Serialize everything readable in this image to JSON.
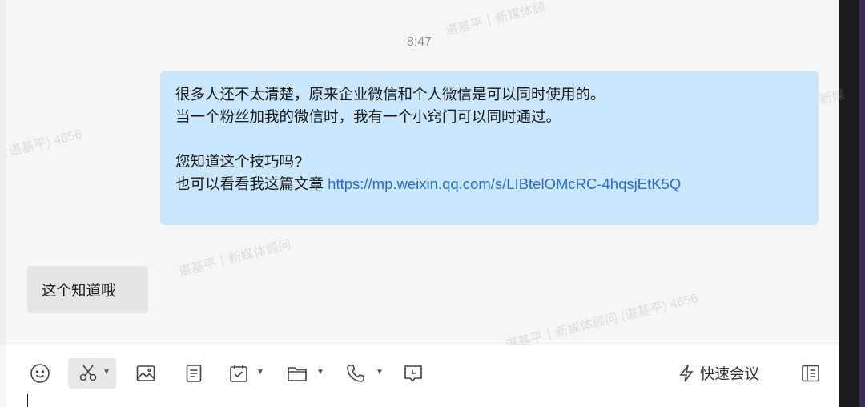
{
  "chat": {
    "timestamp": "8:47",
    "outgoing": {
      "line1": "很多人还不太清楚，原来企业微信和个人微信是可以同时使用的。",
      "line2": "当一个粉丝加我的微信时，我有一个小窍门可以同时通过。",
      "line3": "您知道这个技巧吗?",
      "line4_prefix": "也可以看看我这篇文章 ",
      "line4_link": "https://mp.weixin.qq.com/s/LIBtelOMcRC-4hqsjEtK5Q"
    },
    "incoming": {
      "text": "这个知道哦"
    }
  },
  "watermarks": {
    "w1": "谌基平丨新媒体顾",
    "w2": "谌基平) 4656",
    "w3": "谌基平丨新媒体顾问",
    "w4": "谌基平丨新媒体顾问 (谌基平) 4656",
    "w5": "新媒"
  },
  "toolbar": {
    "icons": [
      "emoji-icon",
      "scissors-icon",
      "image-icon",
      "document-icon",
      "calendar-check-icon",
      "folder-icon",
      "phone-icon",
      "chat-bubble-icon",
      "lightning-icon",
      "sidebar-panel-icon"
    ],
    "quick_meeting_label": "快速会议"
  }
}
